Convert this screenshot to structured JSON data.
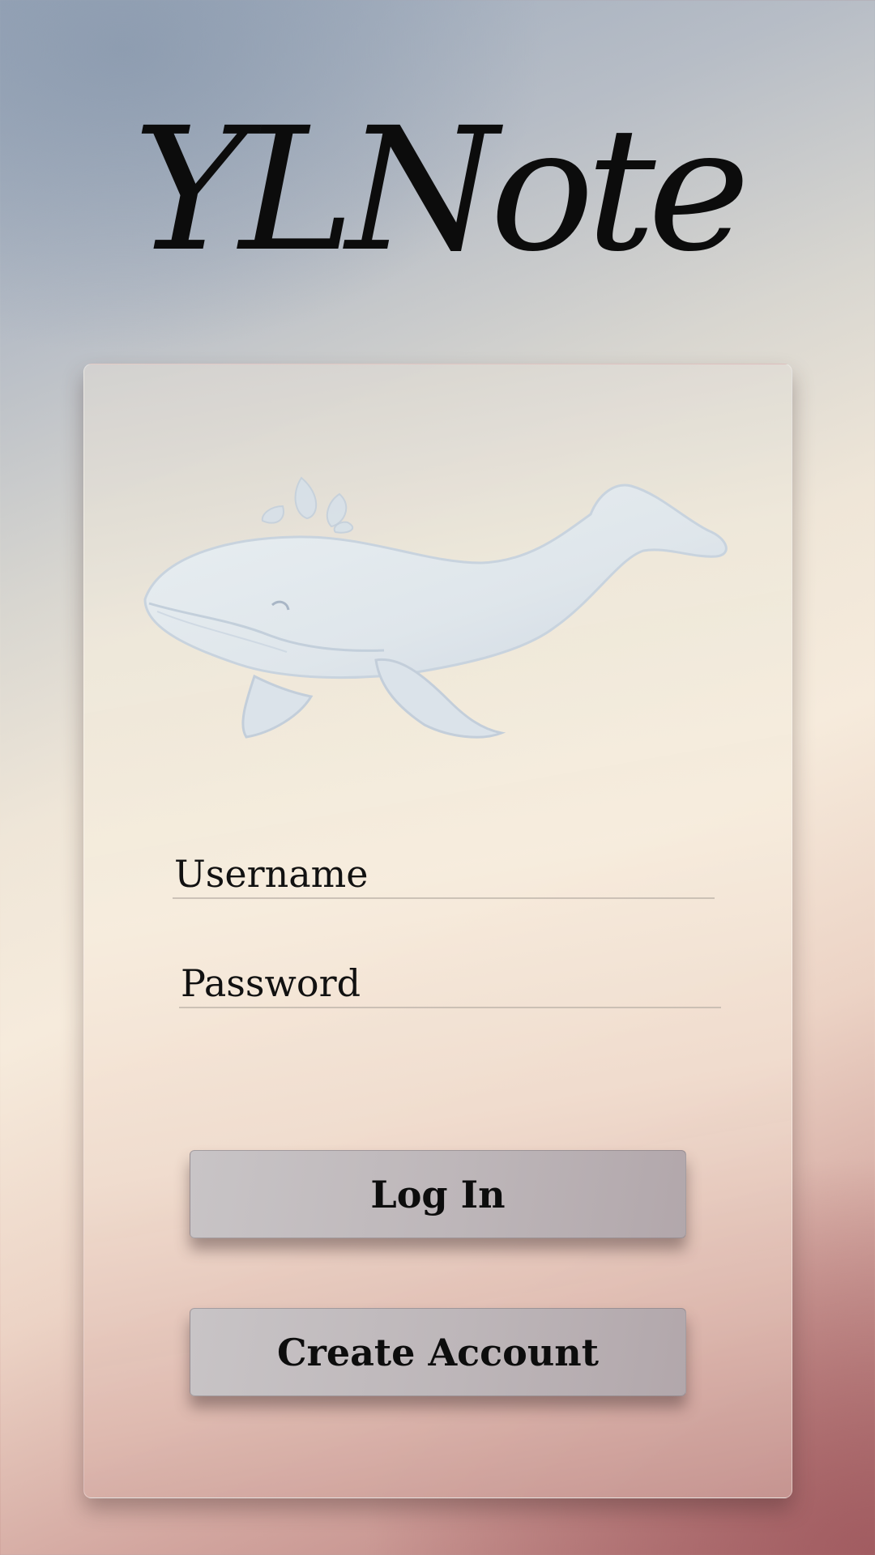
{
  "app": {
    "title": "YLNote"
  },
  "login_form": {
    "username_placeholder": "Username",
    "password_placeholder": "Password",
    "login_label": "Log In",
    "create_account_label": "Create Account"
  },
  "illustration": {
    "icon": "whale-illustration",
    "color": "#dfe6ec"
  },
  "colors": {
    "button": "#bdb6b9",
    "text": "#0c0c0c"
  }
}
